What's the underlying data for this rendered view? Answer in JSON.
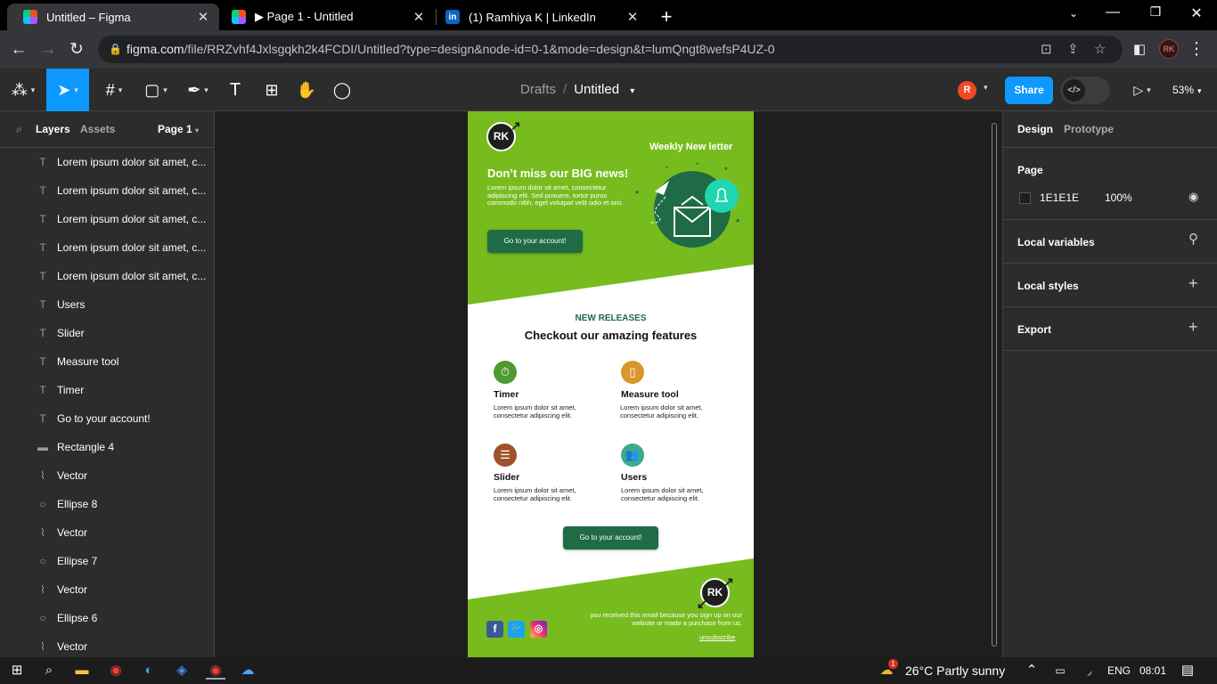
{
  "browser": {
    "tabs": [
      {
        "title": "Untitled – Figma",
        "icon": "figma-icon",
        "active": true
      },
      {
        "title": "▶ Page 1 - Untitled",
        "icon": "figma-icon",
        "active": false
      },
      {
        "title": "(1) Ramhiya K | LinkedIn",
        "icon": "linkedin-icon",
        "active": false
      }
    ],
    "url_host": "figma.com",
    "url_path": "/file/RRZvhf4Jxlsgqkh2k4FCDI/Untitled?type=design&node-id=0-1&mode=design&t=lumQngt8wefsP4UZ-0",
    "profile_initials": "RK"
  },
  "toolbar": {
    "breadcrumb_parent": "Drafts",
    "breadcrumb_file": "Untitled",
    "user_initial": "R",
    "share_label": "Share",
    "zoom": "53%"
  },
  "layers_panel": {
    "tab_layers": "Layers",
    "tab_assets": "Assets",
    "page_name": "Page 1",
    "items": [
      {
        "name": "Lorem ipsum dolor sit amet, c...",
        "type": "text"
      },
      {
        "name": "Lorem ipsum dolor sit amet, c...",
        "type": "text"
      },
      {
        "name": "Lorem ipsum dolor sit amet, c...",
        "type": "text"
      },
      {
        "name": "Lorem ipsum dolor sit amet, c...",
        "type": "text"
      },
      {
        "name": "Lorem ipsum dolor sit amet, c...",
        "type": "text"
      },
      {
        "name": "Users",
        "type": "text"
      },
      {
        "name": "Slider",
        "type": "text"
      },
      {
        "name": "Measure tool",
        "type": "text"
      },
      {
        "name": "Timer",
        "type": "text"
      },
      {
        "name": "Go to your account!",
        "type": "text"
      },
      {
        "name": "Rectangle 4",
        "type": "rectangle"
      },
      {
        "name": "Vector",
        "type": "vector"
      },
      {
        "name": "Ellipse 8",
        "type": "ellipse"
      },
      {
        "name": "Vector",
        "type": "vector"
      },
      {
        "name": "Ellipse 7",
        "type": "ellipse"
      },
      {
        "name": "Vector",
        "type": "vector"
      },
      {
        "name": "Ellipse 6",
        "type": "ellipse"
      },
      {
        "name": "Vector",
        "type": "vector"
      }
    ]
  },
  "email": {
    "logo_text": "RK",
    "weekly_label": "Weekly New letter",
    "hero_title": "Don’t miss our BIG news!",
    "hero_body": "Lorem ipsum dolor sit amet, consectetur adipiscing elit. Sed posuere, tortor purus commodo nibh, eget volutpat velit odio et orci.",
    "cta_label": "Go to your account!",
    "releases_kicker": "NEW RELEASES",
    "releases_title": "Checkout our amazing features",
    "features": [
      {
        "title": "Timer",
        "desc": "Lorem ipsum dolor sit amet, consectetur adipiscing elit.",
        "icon": "timer-icon",
        "color": "#4e9a2f"
      },
      {
        "title": "Measure tool",
        "desc": "Lorem ipsum dolor sit amet, consectetur adipiscing elit.",
        "icon": "ruler-icon",
        "color": "#d9962b"
      },
      {
        "title": "Slider",
        "desc": "Lorem ipsum dolor sit amet, consectetur adipiscing elit.",
        "icon": "sliders-icon",
        "color": "#a0522d"
      },
      {
        "title": "Users",
        "desc": "Lorem ipsum dolor sit amet, consectetur adipiscing elit.",
        "icon": "users-icon",
        "color": "#3fa98f"
      }
    ],
    "cta2_label": "Go to your account!",
    "footer_text": "you received this email because you sign up on our website or made a purchase from us.",
    "unsubscribe": "unsubscribe",
    "accent_green": "#77bc1f",
    "dark_green": "#1e6b45"
  },
  "design_panel": {
    "tab_design": "Design",
    "tab_prototype": "Prototype",
    "page_label": "Page",
    "bg_hex": "1E1E1E",
    "bg_opacity": "100%",
    "local_variables": "Local variables",
    "local_styles": "Local styles",
    "export": "Export"
  },
  "help_label": "?",
  "taskbar": {
    "weather": "26°C  Partly sunny",
    "lang": "ENG",
    "time": "08:01",
    "notification_count": "1"
  }
}
